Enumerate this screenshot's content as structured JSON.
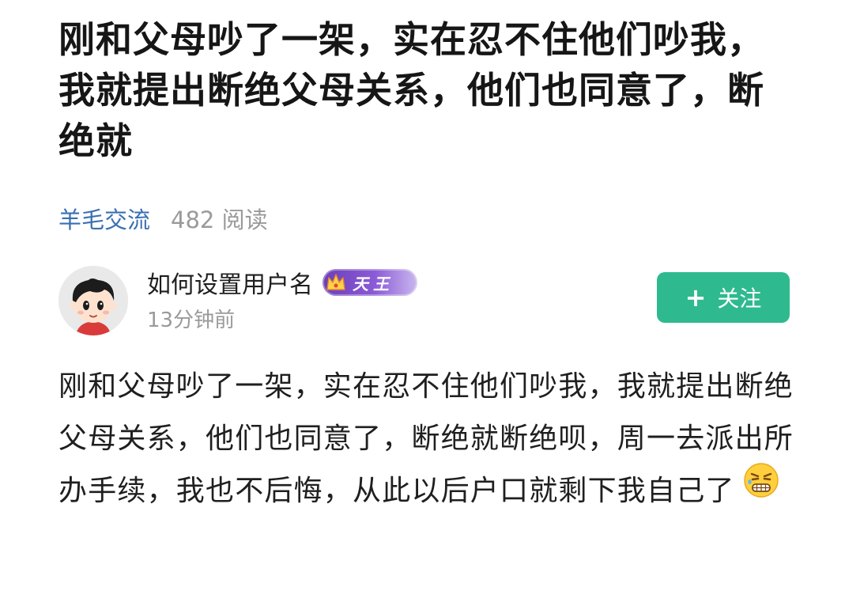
{
  "post": {
    "title": "刚和父母吵了一架，实在忍不住他们吵我，我就提出断绝父母关系，他们也同意了，断绝就",
    "forum": "羊毛交流",
    "read_count": "482 阅读",
    "body": "刚和父母吵了一架，实在忍不住他们吵我，我就提出断绝父母关系，他们也同意了，断绝就断绝呗，周一去派出所办手续，我也不后悔，从此以后户口就剩下我自己了"
  },
  "author": {
    "name": "如何设置用户名",
    "badge_text": "天王",
    "post_time": "13分钟前"
  },
  "actions": {
    "follow_label": "关注",
    "follow_icon": "plus-icon"
  },
  "colors": {
    "forum_link": "#3a6fb2",
    "follow_button": "#2fb98e",
    "badge": "#7a4cc8",
    "secondary_text": "#9a9a9a"
  },
  "icons": {
    "avatar": "cartoon-avatar",
    "badge": "crown-icon",
    "body_end": "grimace-emoji-icon"
  }
}
